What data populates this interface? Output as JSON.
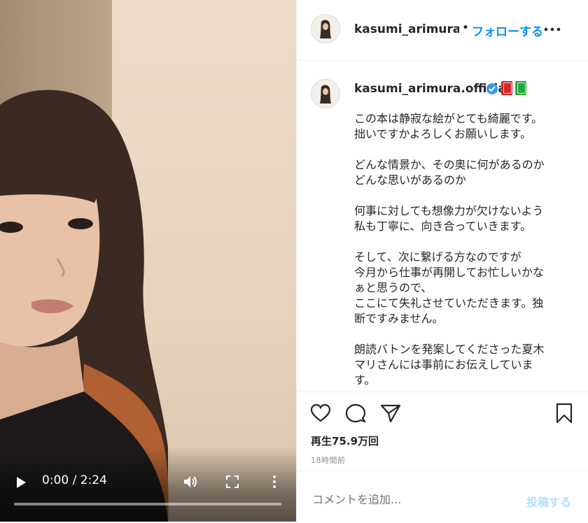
{
  "video": {
    "time_display": "0:00 / 2:24",
    "progress_fraction": 0.0
  },
  "header": {
    "username": "kasumi_arimura.official",
    "separator": "•",
    "follow_label": "フォローする"
  },
  "caption": {
    "username": "kasumi_arimura.official",
    "verified_icon": "verified-badge-icon",
    "emoji": [
      "red-book-emoji",
      "green-book-emoji"
    ],
    "text": "この本は静寂な絵がとても綺麗です。\n拙いですかよろしくお願いします。\n\nどんな情景か、その奥に何があるのか\nどんな思いがあるのか\n\n何事に対しても想像力が欠けないよう\n私も丁寧に、向き合っていきます。\n\nそして、次に繋げる方なのですが\n今月から仕事が再開してお忙しいかな\nぁと思うので、\nここにて失礼させていただきます。独\n断ですみません。\n\n朗読バトンを発案してくださった夏木\nマリさんには事前にお伝えしていま\nす。"
  },
  "stats": {
    "views": "再生75.9万回",
    "posted_ago": "18時間前"
  },
  "comment": {
    "placeholder": "コメントを追加...",
    "post_label": "投稿する"
  },
  "colors": {
    "accent": "#0095f6",
    "post_disabled": "#b2dffc",
    "verified": "#3897f0"
  }
}
